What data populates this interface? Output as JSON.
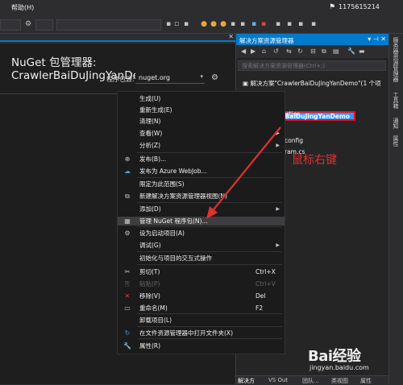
{
  "menubar": {
    "help": "帮助(H)",
    "user": "1175615214"
  },
  "nuget": {
    "title": "NuGet 包管理器: CrawlerBaiDuJingYanDemo",
    "source_label": "程序包源:",
    "source_value": "nuget.org"
  },
  "solution_explorer": {
    "title": "解决方案资源管理器",
    "search_placeholder": "搜索解决方案资源管理器(Ctrl+;)",
    "solution_item": "解决方案\"CrawlerBaiDuJingYanDemo\"(1 个项",
    "project_item": "CrawlerBaiDuJingYanDemo",
    "item_properties": "erties",
    "item_config": "config",
    "item_program": "ram.cs",
    "bottom_tabs": [
      "解决方",
      "VS Out",
      "团队...",
      "类视图",
      "属性"
    ]
  },
  "right_strip": [
    "服务器资源管理器",
    "工具箱",
    "通知",
    "属性"
  ],
  "context_menu": [
    {
      "icon": "",
      "label": "生成(U)",
      "shortcut": "",
      "submenu": false,
      "disabled": false
    },
    {
      "icon": "",
      "label": "重新生成(E)",
      "shortcut": "",
      "submenu": false,
      "disabled": false
    },
    {
      "icon": "",
      "label": "清理(N)",
      "shortcut": "",
      "submenu": false,
      "disabled": false
    },
    {
      "icon": "",
      "label": "查看(W)",
      "shortcut": "",
      "submenu": true,
      "disabled": false
    },
    {
      "icon": "",
      "label": "分析(Z)",
      "shortcut": "",
      "submenu": true,
      "disabled": false
    },
    {
      "icon": "⊕",
      "label": "发布(B)...",
      "shortcut": "",
      "submenu": false,
      "disabled": false
    },
    {
      "icon": "☁",
      "label": "发布为 Azure WebJob...",
      "shortcut": "",
      "submenu": false,
      "disabled": false
    },
    {
      "icon": "",
      "label": "限定为此范围(S)",
      "shortcut": "",
      "submenu": false,
      "disabled": false
    },
    {
      "icon": "⧉",
      "label": "新建解决方案资源管理器视图(N)",
      "shortcut": "",
      "submenu": false,
      "disabled": false
    },
    {
      "icon": "",
      "label": "添加(D)",
      "shortcut": "",
      "submenu": true,
      "disabled": false
    },
    {
      "icon": "▦",
      "label": "管理 NuGet 程序包(N)...",
      "shortcut": "",
      "submenu": false,
      "disabled": false
    },
    {
      "icon": "⚙",
      "label": "设为启动项目(A)",
      "shortcut": "",
      "submenu": false,
      "disabled": false
    },
    {
      "icon": "",
      "label": "调试(G)",
      "shortcut": "",
      "submenu": true,
      "disabled": false
    },
    {
      "icon": "",
      "label": "初始化与项目的交互式操作",
      "shortcut": "",
      "submenu": false,
      "disabled": false
    },
    {
      "icon": "✂",
      "label": "剪切(T)",
      "shortcut": "Ctrl+X",
      "submenu": false,
      "disabled": false
    },
    {
      "icon": "⎘",
      "label": "粘贴(P)",
      "shortcut": "Ctrl+V",
      "submenu": false,
      "disabled": true
    },
    {
      "icon": "✕",
      "label": "移除(V)",
      "shortcut": "Del",
      "submenu": false,
      "disabled": false
    },
    {
      "icon": "▭",
      "label": "重命名(M)",
      "shortcut": "F2",
      "submenu": false,
      "disabled": false
    },
    {
      "icon": "",
      "label": "卸载项目(L)",
      "shortcut": "",
      "submenu": false,
      "disabled": false
    },
    {
      "icon": "↻",
      "label": "在文件资源管理器中打开文件夹(X)",
      "shortcut": "",
      "submenu": false,
      "disabled": false
    },
    {
      "icon": "🔧",
      "label": "属性(R)",
      "shortcut": "",
      "submenu": false,
      "disabled": false
    }
  ],
  "annotation": {
    "text": "鼠标右键",
    "color": "#e03030"
  },
  "watermark": {
    "logo": "Bai经验",
    "url": "jingyan.baidu.com"
  },
  "colors": {
    "accent": "#007acc",
    "selection": "#3399ff",
    "highlight_box": "#e81123"
  }
}
